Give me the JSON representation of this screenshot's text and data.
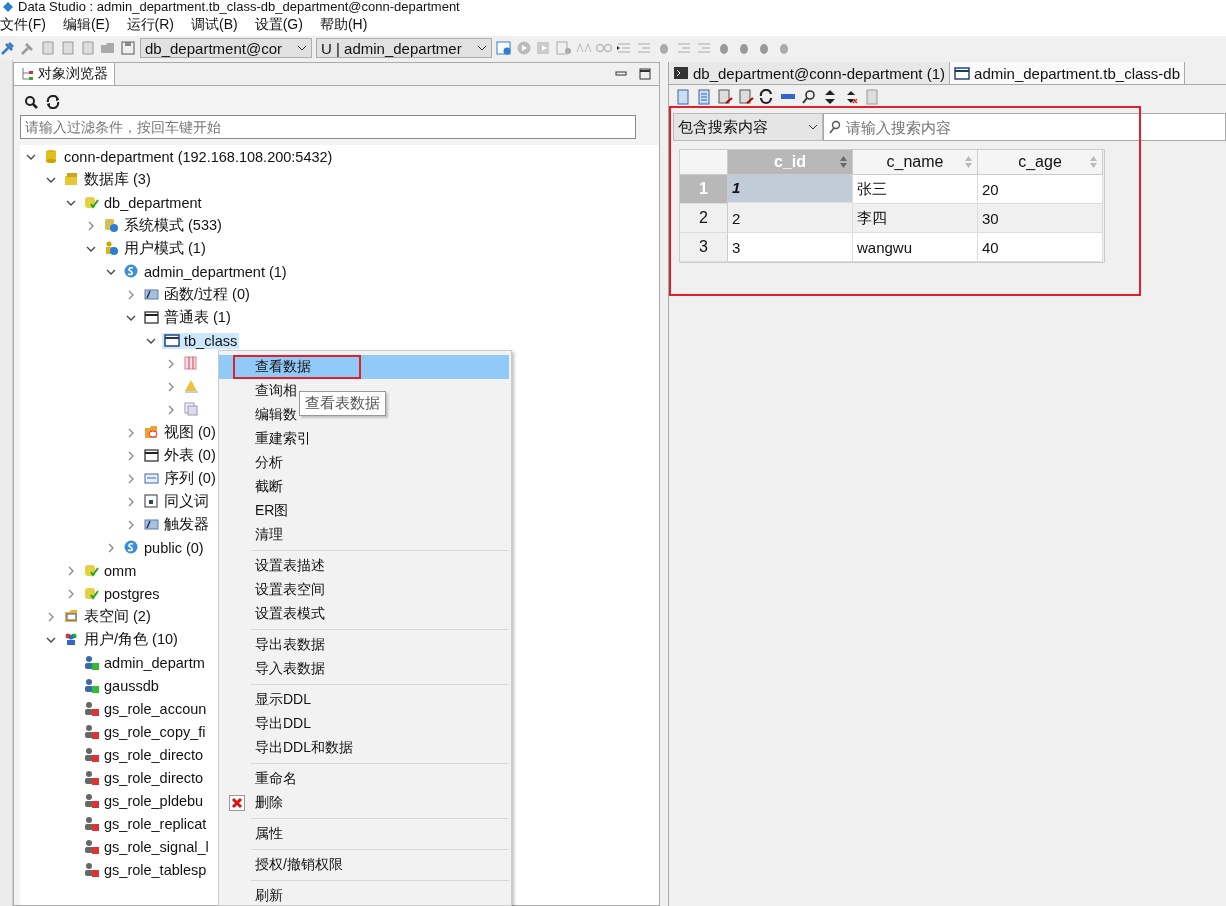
{
  "window": {
    "title": "Data Studio : admin_department.tb_class-db_department@conn-department"
  },
  "menu_bar": [
    "文件(F)",
    "编辑(E)",
    "运行(R)",
    "调试(B)",
    "设置(G)",
    "帮助(H)"
  ],
  "toolbar": {
    "connection_combo": "db_department@cor",
    "schema_combo": "U | admin_departmer"
  },
  "object_browser": {
    "tab": {
      "label": "对象浏览器",
      "selected": true
    },
    "filter": {
      "placeholder": "请输入过滤条件，按回车键开始"
    },
    "tree": [
      {
        "label": "conn-department (192.168.108.200:5432)",
        "kind": "connection",
        "expanded": true,
        "selected": false,
        "children": [
          {
            "label": "数据库 (3)",
            "kind": "databases",
            "expanded": true,
            "selected": false,
            "children": [
              {
                "label": "db_department",
                "kind": "database",
                "expanded": true,
                "selected": false,
                "children": [
                  {
                    "label": "系统模式 (533)",
                    "kind": "system-schemas",
                    "expanded": false,
                    "selected": false
                  },
                  {
                    "label": "用户模式 (1)",
                    "kind": "user-schemas",
                    "expanded": true,
                    "selected": false,
                    "children": [
                      {
                        "label": "admin_department (1)",
                        "kind": "schema",
                        "expanded": true,
                        "selected": false,
                        "children": [
                          {
                            "label": "函数/过程 (0)",
                            "kind": "functions",
                            "expanded": false,
                            "selected": false
                          },
                          {
                            "label": "普通表 (1)",
                            "kind": "tables",
                            "expanded": true,
                            "selected": false,
                            "children": [
                              {
                                "label": "tb_class",
                                "kind": "table",
                                "expanded": true,
                                "selected": true,
                                "children": [
                                  {
                                    "kind": "columns",
                                    "expanded": false,
                                    "selected": false
                                  },
                                  {
                                    "kind": "constraints",
                                    "expanded": false,
                                    "selected": false
                                  },
                                  {
                                    "kind": "indexes",
                                    "expanded": false,
                                    "selected": false
                                  }
                                ]
                              }
                            ]
                          },
                          {
                            "label": "视图 (0)",
                            "kind": "views",
                            "expanded": false,
                            "selected": false
                          },
                          {
                            "label": "外表 (0)",
                            "kind": "tables",
                            "expanded": false,
                            "selected": false
                          },
                          {
                            "label": "序列 (0)",
                            "kind": "sequences",
                            "expanded": false,
                            "selected": false
                          },
                          {
                            "label": "同义词",
                            "kind": "synonyms",
                            "expanded": false,
                            "selected": false
                          },
                          {
                            "label": "触发器",
                            "kind": "functions",
                            "expanded": false,
                            "selected": false
                          }
                        ]
                      },
                      {
                        "label": "public (0)",
                        "kind": "schema",
                        "expanded": false,
                        "selected": false
                      }
                    ]
                  }
                ]
              },
              {
                "label": "omm",
                "kind": "database",
                "expanded": false,
                "selected": false
              },
              {
                "label": "postgres",
                "kind": "database",
                "expanded": false,
                "selected": false
              }
            ]
          },
          {
            "label": "表空间 (2)",
            "kind": "tablespaces",
            "expanded": false,
            "selected": false
          },
          {
            "label": "用户/角色 (10)",
            "kind": "roles",
            "expanded": true,
            "selected": false,
            "children": [
              {
                "label": "admin_departm",
                "kind": "user",
                "selected": false
              },
              {
                "label": "gaussdb",
                "kind": "user",
                "selected": false
              },
              {
                "label": "gs_role_accoun",
                "kind": "role",
                "selected": false
              },
              {
                "label": "gs_role_copy_fi",
                "kind": "role",
                "selected": false
              },
              {
                "label": "gs_role_directo",
                "kind": "role",
                "selected": false
              },
              {
                "label": "gs_role_directo",
                "kind": "role",
                "selected": false
              },
              {
                "label": "gs_role_pldebu",
                "kind": "role",
                "selected": false
              },
              {
                "label": "gs_role_replicat",
                "kind": "role",
                "selected": false
              },
              {
                "label": "gs_role_signal_l",
                "kind": "role",
                "selected": false
              },
              {
                "label": "gs_role_tablesp",
                "kind": "role",
                "selected": false
              }
            ]
          }
        ]
      }
    ]
  },
  "context_menu": {
    "groups": [
      [
        {
          "label": "查看数据",
          "kind": "plain",
          "selected": true,
          "marked": true
        },
        {
          "label": "查询相",
          "kind": "plain",
          "selected": false,
          "marked": false
        },
        {
          "label": "编辑数",
          "kind": "plain",
          "selected": false,
          "marked": false
        },
        {
          "label": "重建索引",
          "kind": "plain",
          "selected": false,
          "marked": false
        },
        {
          "label": "分析",
          "kind": "plain",
          "selected": false,
          "marked": false
        },
        {
          "label": "截断",
          "kind": "plain",
          "selected": false,
          "marked": false
        },
        {
          "label": "ER图",
          "kind": "plain",
          "selected": false,
          "marked": false
        },
        {
          "label": "清理",
          "kind": "plain",
          "selected": false,
          "marked": false
        }
      ],
      [
        {
          "label": "设置表描述",
          "kind": "plain",
          "selected": false,
          "marked": false
        },
        {
          "label": "设置表空间",
          "kind": "plain",
          "selected": false,
          "marked": false
        },
        {
          "label": "设置表模式",
          "kind": "plain",
          "selected": false,
          "marked": false
        }
      ],
      [
        {
          "label": "导出表数据",
          "kind": "plain",
          "selected": false,
          "marked": false
        },
        {
          "label": "导入表数据",
          "kind": "plain",
          "selected": false,
          "marked": false
        }
      ],
      [
        {
          "label": "显示DDL",
          "kind": "plain",
          "selected": false,
          "marked": false
        },
        {
          "label": "导出DDL",
          "kind": "plain",
          "selected": false,
          "marked": false
        },
        {
          "label": "导出DDL和数据",
          "kind": "plain",
          "selected": false,
          "marked": false
        }
      ],
      [
        {
          "label": "重命名",
          "kind": "plain",
          "selected": false,
          "marked": false
        },
        {
          "label": "删除",
          "kind": "delete",
          "selected": false,
          "marked": false
        }
      ],
      [
        {
          "label": "属性",
          "kind": "plain",
          "selected": false,
          "marked": false
        }
      ],
      [
        {
          "label": "授权/撤销权限",
          "kind": "plain",
          "selected": false,
          "marked": false
        }
      ],
      [
        {
          "label": "刷新",
          "kind": "plain",
          "selected": false,
          "marked": false
        }
      ]
    ]
  },
  "tooltip": "查看表数据",
  "editor": {
    "tabs": [
      {
        "label": "db_department@conn-department (1)",
        "kind": "terminal",
        "selected": false
      },
      {
        "label": "admin_department.tb_class-db",
        "kind": "table",
        "selected": true
      }
    ],
    "marked": true,
    "search_mode": "包含搜索内容",
    "search": {
      "placeholder": "请输入搜索内容"
    },
    "table": {
      "columns": [
        {
          "label": "c_id",
          "selected": true
        },
        {
          "label": "c_name",
          "selected": false
        },
        {
          "label": "c_age",
          "selected": false
        }
      ],
      "rows": [
        {
          "number": "1",
          "selected": true,
          "cells": [
            "1",
            "张三",
            "20"
          ]
        },
        {
          "number": "2",
          "selected": false,
          "cells": [
            "2",
            "李四",
            "30"
          ]
        },
        {
          "number": "3",
          "selected": false,
          "cells": [
            "3",
            "wangwu",
            "40"
          ]
        }
      ]
    }
  }
}
